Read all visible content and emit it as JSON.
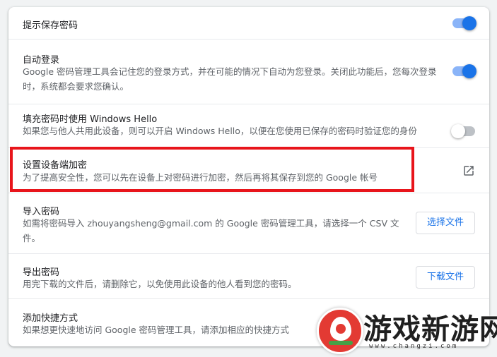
{
  "settings": {
    "offer_save": {
      "title": "提示保存密码",
      "enabled": true
    },
    "auto_signin": {
      "title": "自动登录",
      "desc": "Google 密码管理工具会记住您的登录方式，并在可能的情况下自动为您登录。关闭此功能后，您每次登录时，系统都会要求您确认。",
      "enabled": true
    },
    "windows_hello": {
      "title": "填充密码时使用 Windows Hello",
      "desc": "如果您与他人共用此设备，则可以开启 Windows Hello，以便在您使用已保存的密码时验证您的身份",
      "enabled": false
    },
    "device_encryption": {
      "title": "设置设备端加密",
      "desc": "为了提高安全性，您可以先在设备上对密码进行加密，然后再将其保存到您的 Google 帐号",
      "icon": "open-in-new-icon"
    },
    "import": {
      "title": "导入密码",
      "desc": "如需将密码导入 zhouyangsheng@gmail.com 的 Google 密码管理工具，请选择一个 CSV 文件。",
      "button": "选择文件"
    },
    "export": {
      "title": "导出密码",
      "desc": "用完下载的文件后，请删除它，以免使用此设备的他人看到您的密码。",
      "button": "下载文件"
    },
    "shortcut": {
      "title": "添加快捷方式",
      "desc": "如果想更快速地访问 Google 密码管理工具，请添加相应的快捷方式"
    }
  },
  "watermark": {
    "title": "游戏新游网",
    "url": "www.changzi.com"
  },
  "colors": {
    "accent": "#1a73e8",
    "highlight": "#e8151b"
  }
}
